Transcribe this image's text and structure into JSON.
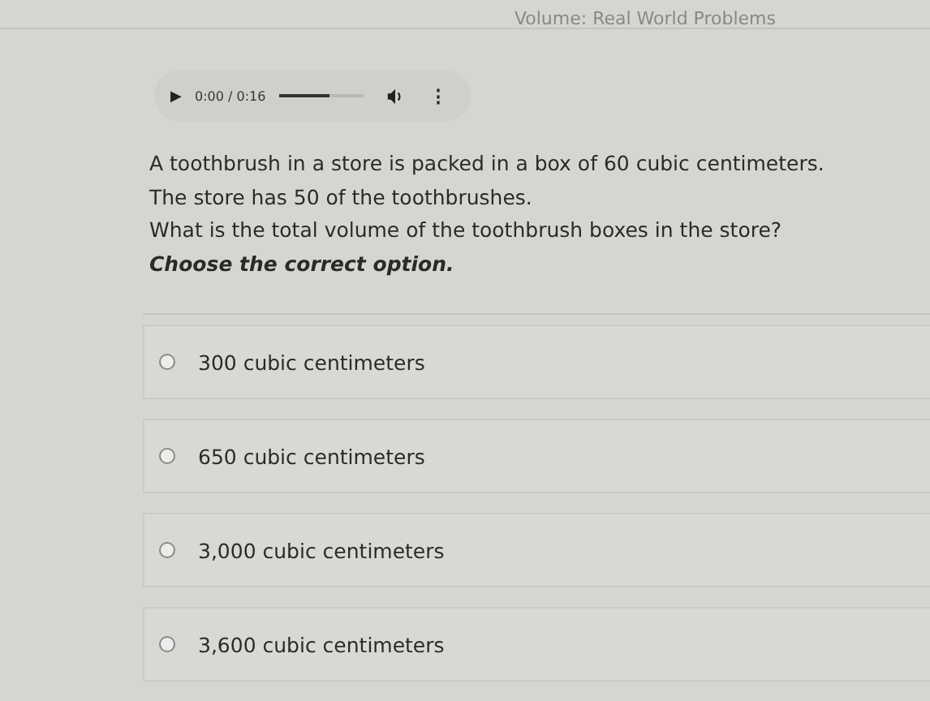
{
  "header": {
    "title": "Volume: Real World Problems"
  },
  "audio_player": {
    "play": "▶",
    "time": "0:00 / 0:16",
    "level": 0.6,
    "menu": "⋮"
  },
  "question": {
    "lines": [
      "A toothbrush in a store is packed in a box of 60 cubic centimeters.",
      "The store has 50 of the toothbrushes.",
      "What is the total volume of the toothbrush boxes in the store?"
    ],
    "instruction": "Choose the correct option."
  },
  "options": [
    {
      "label": "300 cubic centimeters",
      "selected": false
    },
    {
      "label": "650 cubic centimeters",
      "selected": false
    },
    {
      "label": "3,000 cubic centimeters",
      "selected": false
    },
    {
      "label": "3,600 cubic centimeters",
      "selected": false
    }
  ]
}
